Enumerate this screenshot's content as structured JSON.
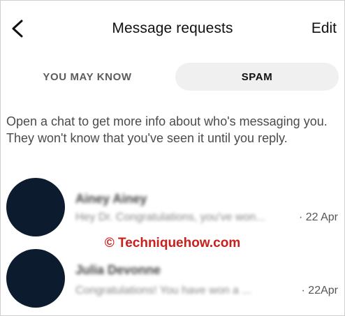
{
  "header": {
    "back_icon": "chevron-left-icon",
    "title": "Message requests",
    "edit_label": "Edit"
  },
  "tabs": [
    {
      "label": "YOU MAY KNOW",
      "selected": false
    },
    {
      "label": "SPAM",
      "selected": true
    }
  ],
  "info_text": "Open a chat to get more info about who's messaging you. They won't know that you've seen it until you reply.",
  "requests": [
    {
      "name": "Ainey Ainey",
      "preview": "Hey Dr. Congratulations, you've won...",
      "separator": "·",
      "date": "22 Apr"
    },
    {
      "name": "Julia Devonne",
      "preview": "Congratulations! You have won a ...",
      "separator": "·",
      "date": "22Apr"
    }
  ],
  "watermark": "© Techniquehow.com",
  "colors": {
    "avatar": "#0d1b2e",
    "watermark": "#c8201c",
    "selected_tab_bg": "#f0f0f0"
  }
}
